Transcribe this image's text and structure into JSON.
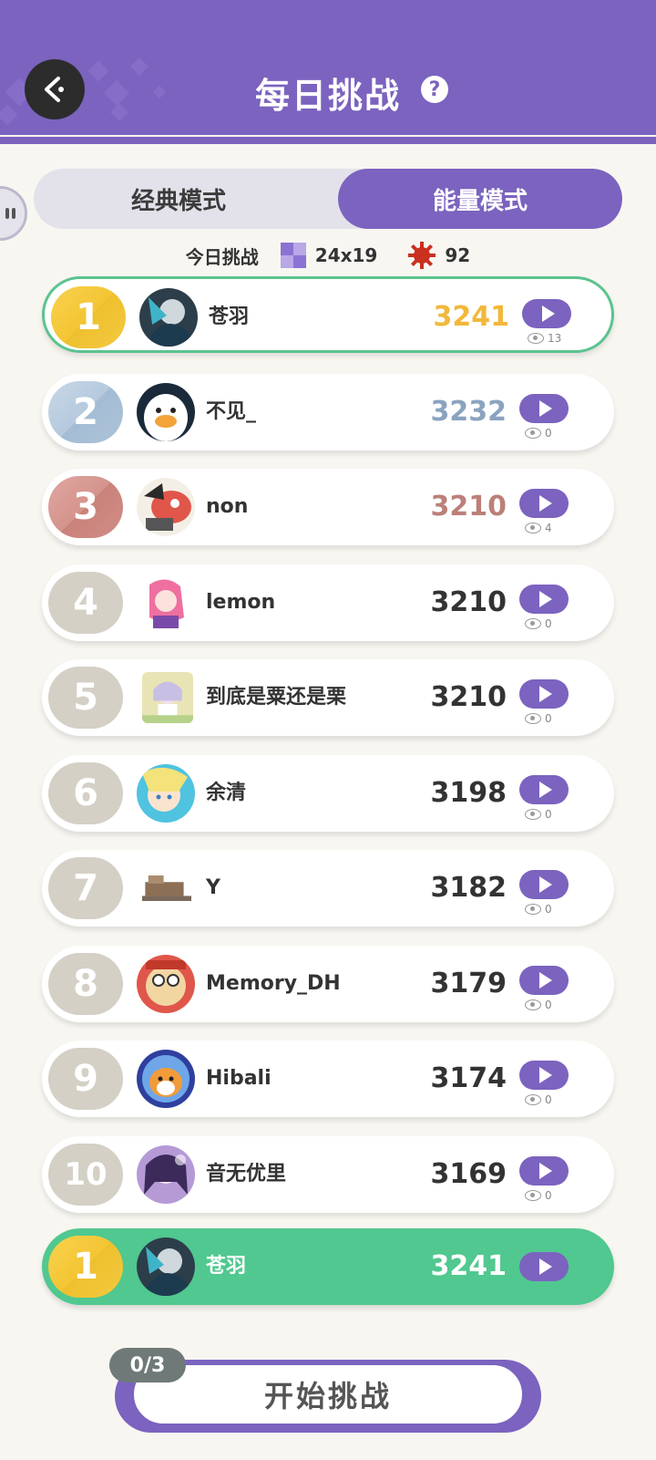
{
  "header": {
    "title": "每日挑战"
  },
  "modes": [
    {
      "label": "经典模式",
      "active": false
    },
    {
      "label": "能量模式",
      "active": true
    }
  ],
  "today": {
    "label": "今日挑战",
    "board_size": "24x19",
    "mines": "92"
  },
  "leaderboard": [
    {
      "rank": "1",
      "name": "苍羽",
      "score": "3241",
      "views": "13",
      "score_color": "#f2b83b"
    },
    {
      "rank": "2",
      "name": "不见_",
      "score": "3232",
      "views": "0",
      "score_color": "#8aa3bf"
    },
    {
      "rank": "3",
      "name": "non",
      "score": "3210",
      "views": "4",
      "score_color": "#bb8079"
    },
    {
      "rank": "4",
      "name": "lemon",
      "score": "3210",
      "views": "0",
      "score_color": "#333333"
    },
    {
      "rank": "5",
      "name": "到底是粟还是栗",
      "score": "3210",
      "views": "0",
      "score_color": "#333333"
    },
    {
      "rank": "6",
      "name": "余清",
      "score": "3198",
      "views": "0",
      "score_color": "#333333"
    },
    {
      "rank": "7",
      "name": "Y",
      "score": "3182",
      "views": "0",
      "score_color": "#333333"
    },
    {
      "rank": "8",
      "name": "Memory_DH",
      "score": "3179",
      "views": "0",
      "score_color": "#333333"
    },
    {
      "rank": "9",
      "name": "Hibali",
      "score": "3174",
      "views": "0",
      "score_color": "#333333"
    },
    {
      "rank": "10",
      "name": "音无优里",
      "score": "3169",
      "views": "0",
      "score_color": "#333333"
    }
  ],
  "my_rank": {
    "rank": "1",
    "name": "苍羽",
    "score": "3241"
  },
  "start": {
    "label": "开始挑战",
    "attempts": "0/3"
  },
  "colors": {
    "accent": "#7b63bf",
    "highlight": "#50c88f",
    "background": "#f8f6f1"
  }
}
